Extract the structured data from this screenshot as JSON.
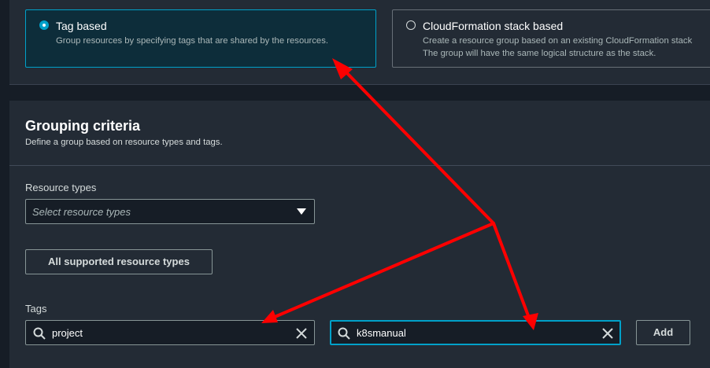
{
  "group_type": {
    "tag_based": {
      "title": "Tag based",
      "description": "Group resources by specifying tags that are shared by the resources.",
      "selected": true
    },
    "cloudformation": {
      "title": "CloudFormation stack based",
      "description_line1": "Create a resource group based on an existing CloudFormation stack",
      "description_line2": "The group will have the same logical structure as the stack.",
      "selected": false
    }
  },
  "grouping_criteria": {
    "title": "Grouping criteria",
    "description": "Define a group based on resource types and tags.",
    "resource_types_label": "Resource types",
    "resource_types_placeholder": "Select resource types",
    "all_types_button": "All supported resource types",
    "tags_label": "Tags",
    "tag_key_value": "project",
    "tag_value_value": "k8smanual",
    "add_button": "Add"
  },
  "icons": {
    "search": "search-icon",
    "clear": "close-icon",
    "dropdown": "caret-down-icon"
  },
  "colors": {
    "accent": "#00a1c9",
    "annotation_arrow": "#ff0000"
  }
}
